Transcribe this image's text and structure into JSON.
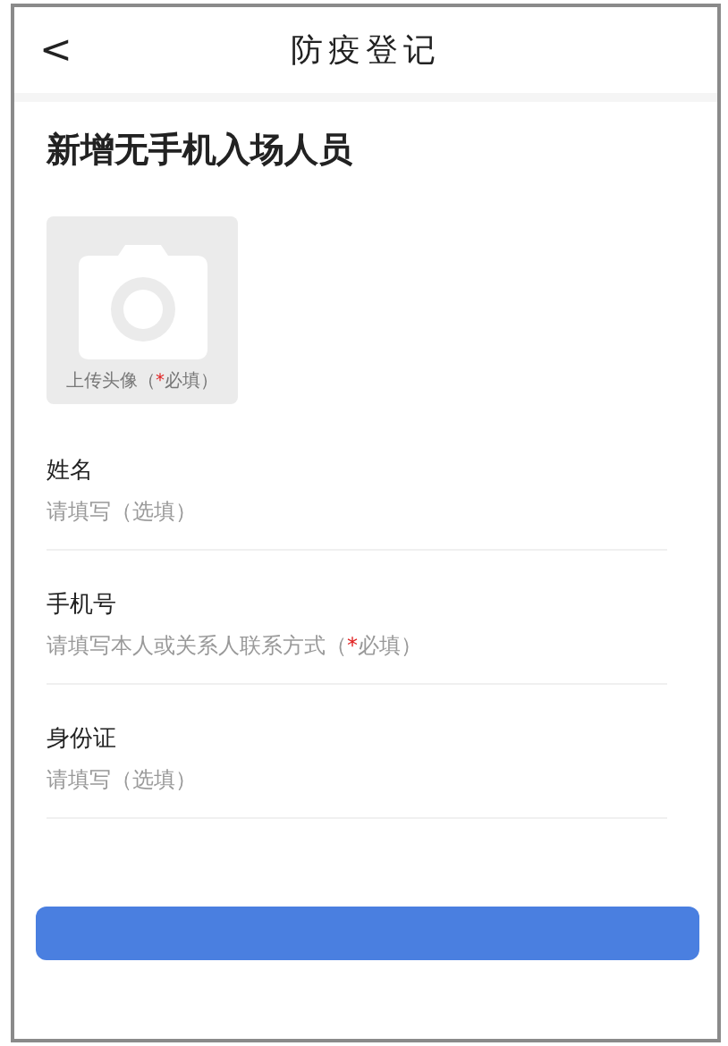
{
  "header": {
    "back": "<",
    "title": "防疫登记"
  },
  "heading": "新增无手机入场人员",
  "upload": {
    "label": "上传头像（",
    "mark": "*",
    "label_end": "必填）"
  },
  "fields": [
    {
      "label": "姓名",
      "placeholder": "请填写（选填）"
    },
    {
      "label": "手机号",
      "placeholder": "请填写本人或关系人联系方式（",
      "mark": "*",
      "placeholder_end": "必填）"
    },
    {
      "label": "身份证",
      "placeholder": "请填写（选填）"
    }
  ],
  "submit": {
    "kind": "primary"
  }
}
